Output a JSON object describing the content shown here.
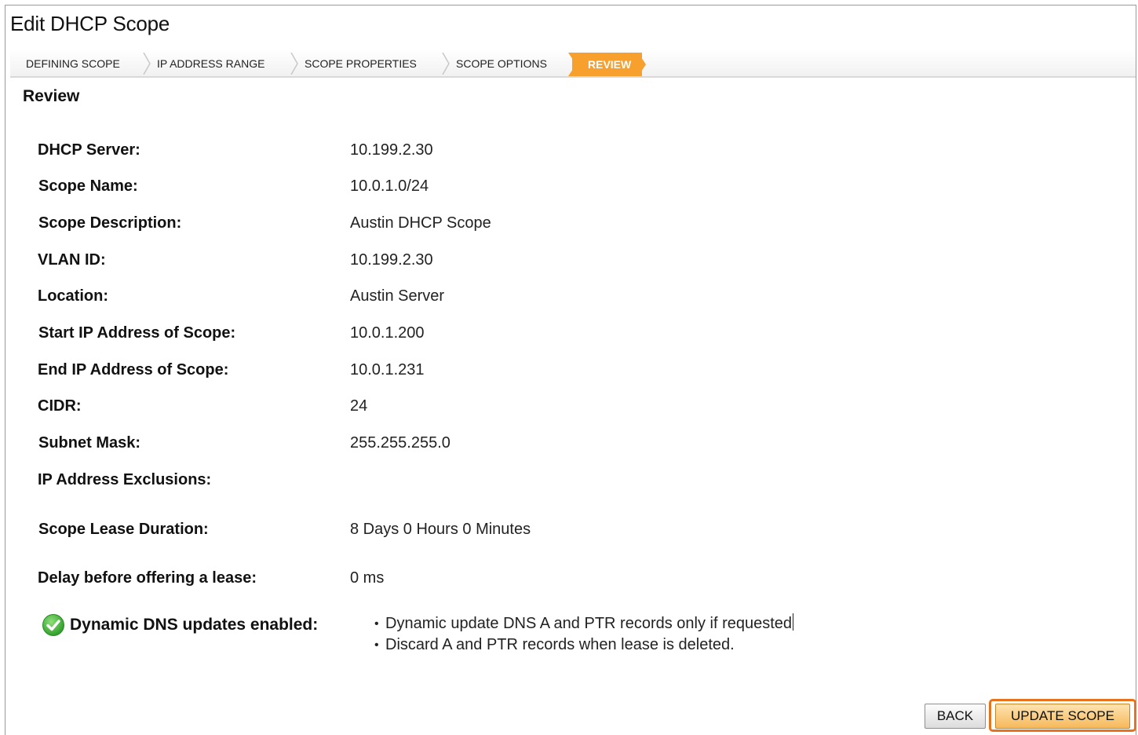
{
  "window": {
    "title": "Edit DHCP Scope"
  },
  "wizard": {
    "steps": [
      {
        "label": "DEFINING SCOPE",
        "active": false
      },
      {
        "label": "IP ADDRESS RANGE",
        "active": false
      },
      {
        "label": "SCOPE PROPERTIES",
        "active": false
      },
      {
        "label": "SCOPE OPTIONS",
        "active": false
      },
      {
        "label": "REVIEW",
        "active": true
      }
    ],
    "accent_color": "#f7a02d"
  },
  "review": {
    "heading": "Review",
    "fields": [
      {
        "label": "DHCP Server:",
        "value": "10.199.2.30"
      },
      {
        "label": "Scope Name:",
        "value": "10.0.1.0/24"
      },
      {
        "label": "Scope Description:",
        "value": "Austin DHCP Scope"
      },
      {
        "label": "VLAN ID:",
        "value": "10.199.2.30"
      },
      {
        "label": "Location:",
        "value": "Austin Server"
      },
      {
        "label": "Start IP Address of Scope:",
        "value": "10.0.1.200"
      },
      {
        "label": "End IP Address of Scope:",
        "value": "10.0.1.231"
      },
      {
        "label": "CIDR:",
        "value": "24"
      },
      {
        "label": "Subnet Mask:",
        "value": "255.255.255.0"
      },
      {
        "label": "IP Address Exclusions:",
        "value": ""
      },
      {
        "label": "Scope Lease Duration:",
        "value": "8 Days 0 Hours 0 Minutes"
      },
      {
        "label": "Delay before offering a lease:",
        "value": "0 ms"
      }
    ],
    "dns": {
      "icon": "check-circle-icon",
      "label": "Dynamic DNS updates enabled:",
      "items": [
        "Dynamic update DNS A and PTR records only if requested",
        "Discard A and PTR records when lease is deleted."
      ]
    }
  },
  "actions": {
    "back_label": "BACK",
    "update_label": "UPDATE SCOPE",
    "highlight_color": "#e8731c"
  }
}
